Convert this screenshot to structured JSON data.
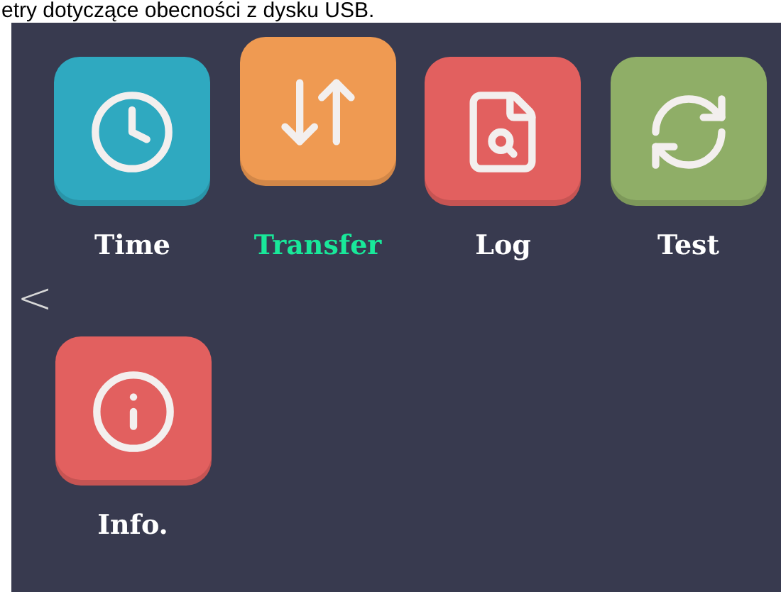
{
  "caption": "etry dotyczące obecności z dysku USB.",
  "back": {
    "glyph": "<"
  },
  "rows": [
    [
      {
        "label": "Time",
        "kind": "clock",
        "color": "#2fa9c0",
        "selected": false
      },
      {
        "label": "Transfer",
        "kind": "transfer",
        "color": "#ef9a52",
        "selected": true
      },
      {
        "label": "Log",
        "kind": "log",
        "color": "#e2605f",
        "selected": false
      },
      {
        "label": "Test",
        "kind": "sync",
        "color": "#8fae67",
        "selected": false
      }
    ],
    [
      {
        "label": "Info.",
        "kind": "info",
        "color": "#e2605f",
        "selected": false
      }
    ]
  ]
}
